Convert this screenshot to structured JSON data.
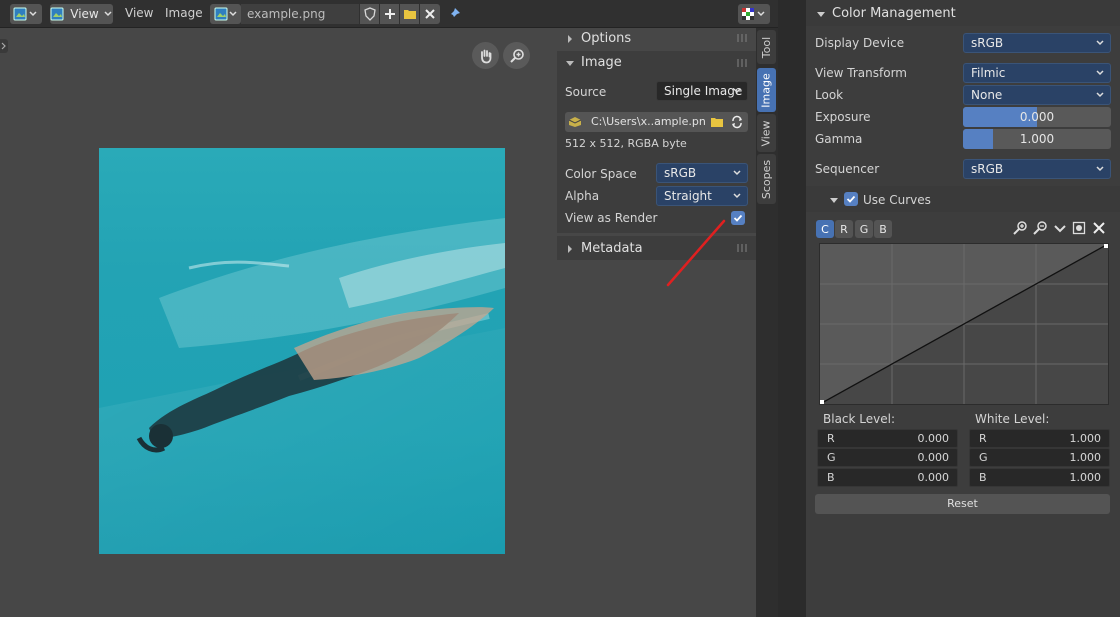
{
  "header": {
    "view_menu_button": "View",
    "menus": [
      "View",
      "Image"
    ],
    "image_name": "example.png"
  },
  "tabs": [
    "Tool",
    "Image",
    "View",
    "Scopes"
  ],
  "npanel": {
    "options_label": "Options",
    "image_label": "Image",
    "source_label": "Source",
    "source_value": "Single Image",
    "filepath": "C:\\Users\\x..ample.png",
    "info": "512 x 512,  RGBA byte",
    "colorspace_label": "Color Space",
    "colorspace_value": "sRGB",
    "alpha_label": "Alpha",
    "alpha_value": "Straight",
    "view_as_render_label": "View as Render",
    "view_as_render_checked": true,
    "metadata_label": "Metadata"
  },
  "color_management": {
    "title": "Color Management",
    "display_device_label": "Display Device",
    "display_device_value": "sRGB",
    "view_transform_label": "View Transform",
    "view_transform_value": "Filmic",
    "look_label": "Look",
    "look_value": "None",
    "exposure_label": "Exposure",
    "exposure_value": "0.000",
    "exposure_fill": 0.5,
    "gamma_label": "Gamma",
    "gamma_value": "1.000",
    "gamma_fill": 0.2,
    "sequencer_label": "Sequencer",
    "sequencer_value": "sRGB",
    "use_curves_label": "Use Curves",
    "use_curves_checked": true,
    "channels": [
      "C",
      "R",
      "G",
      "B"
    ],
    "black_level_label": "Black Level:",
    "white_level_label": "White Level:",
    "black_levels": [
      {
        "k": "R",
        "v": "0.000"
      },
      {
        "k": "G",
        "v": "0.000"
      },
      {
        "k": "B",
        "v": "0.000"
      }
    ],
    "white_levels": [
      {
        "k": "R",
        "v": "1.000"
      },
      {
        "k": "G",
        "v": "1.000"
      },
      {
        "k": "B",
        "v": "1.000"
      }
    ],
    "reset_label": "Reset"
  },
  "colors": {
    "accent": "#4772b3",
    "dropdown_bg": "#2a4266",
    "annotation_arrow": "#e02020"
  }
}
